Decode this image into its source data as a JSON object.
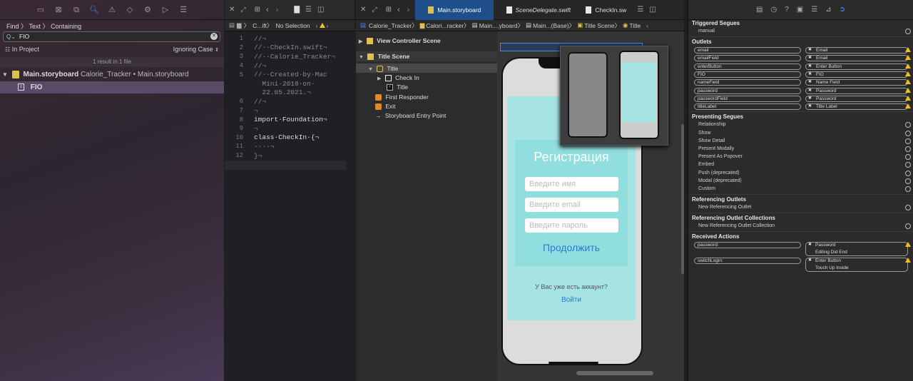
{
  "navigator": {
    "breadcrumb": [
      "Find",
      "Text",
      "Containing"
    ],
    "search_value": "FIO",
    "scope": "In Project",
    "matching": "Ignoring Case",
    "result_summary": "1 result in 1 file",
    "file_result": {
      "name": "Main.storyboard",
      "path": "Calorie_Tracker • Main.storyboard"
    },
    "match_item": "FIO"
  },
  "code_editor": {
    "jump_bar": [
      "C...ift",
      "No Selection"
    ],
    "lines": [
      {
        "n": "1",
        "text": "//¬"
      },
      {
        "n": "2",
        "text": "//··CheckIn.swift¬"
      },
      {
        "n": "3",
        "text": "//··Calorie_Tracker¬"
      },
      {
        "n": "4",
        "text": "//¬"
      },
      {
        "n": "5",
        "text": "//··Created·by·Mac"
      },
      {
        "n": "",
        "text": "  Mini·2018·on·"
      },
      {
        "n": "",
        "text": "  22.05.2021.¬"
      },
      {
        "n": "6",
        "text": "//¬"
      },
      {
        "n": "7",
        "text": "¬"
      },
      {
        "n": "8",
        "text": "import·Foundation¬"
      },
      {
        "n": "9",
        "text": "¬"
      },
      {
        "n": "10",
        "text": "class·CheckIn·{¬"
      },
      {
        "n": "11",
        "text": "····¬"
      },
      {
        "n": "12",
        "text": "}¬"
      },
      {
        "n": "13",
        "text": ""
      }
    ]
  },
  "tabs": [
    {
      "label": "Main.storyboard",
      "active": true
    },
    {
      "label": "SceneDelegate.swift",
      "active": false
    },
    {
      "label": "CheckIn.sw",
      "active": false
    }
  ],
  "storyboard_jump_bar": [
    "Calorie_Tracker",
    "Calori...racker",
    "Main....yboard",
    "Main...(Base)",
    "Title Scene",
    "Title"
  ],
  "outline": {
    "view_controller_scene": "View Controller Scene",
    "title_scene": "Title Scene",
    "title": "Title",
    "check_in": "Check In",
    "title_child": "Title",
    "first_responder": "First Responder",
    "exit": "Exit",
    "entry_point": "Storyboard Entry Point"
  },
  "phone": {
    "heading": "Регистрация",
    "name_placeholder": "Введите имя",
    "email_placeholder": "Введите email",
    "password_placeholder": "Введите пароль",
    "continue_button": "Продолжить",
    "have_account": "У Вас уже есть аккаунт?",
    "login_link": "Войти"
  },
  "inspector": {
    "triggered_segues": {
      "title": "Triggered Segues",
      "items": [
        "manual"
      ]
    },
    "outlets": {
      "title": "Outlets",
      "items": [
        {
          "name": "email",
          "target": "Email"
        },
        {
          "name": "emailField",
          "target": "Email"
        },
        {
          "name": "enterButton",
          "target": "Enter Button"
        },
        {
          "name": "FIO",
          "target": "FIO"
        },
        {
          "name": "nameField",
          "target": "Name Field"
        },
        {
          "name": "password",
          "target": "Password"
        },
        {
          "name": "passwordField",
          "target": "Password"
        },
        {
          "name": "titleLabel",
          "target": "Title Label"
        }
      ]
    },
    "presenting_segues": {
      "title": "Presenting Segues",
      "items": [
        "Relationship",
        "Show",
        "Show Detail",
        "Present Modally",
        "Present As Popover",
        "Embed",
        "Push (deprecated)",
        "Modal (deprecated)",
        "Custom"
      ]
    },
    "referencing_outlets": {
      "title": "Referencing Outlets",
      "items": [
        "New Referencing Outlet"
      ]
    },
    "referencing_collections": {
      "title": "Referencing Outlet Collections",
      "items": [
        "New Referencing Outlet Collection"
      ]
    },
    "received_actions": {
      "title": "Received Actions",
      "items": [
        {
          "name": "password:",
          "target": "Password",
          "event": "Editing Did End"
        },
        {
          "name": "switchLogin:",
          "target": "Enter Button",
          "event": "Touch Up Inside"
        }
      ]
    }
  },
  "colors": {
    "accent": "#3d8cf0",
    "warning": "#f0c020",
    "phone_panel": "#a6e3e3"
  }
}
